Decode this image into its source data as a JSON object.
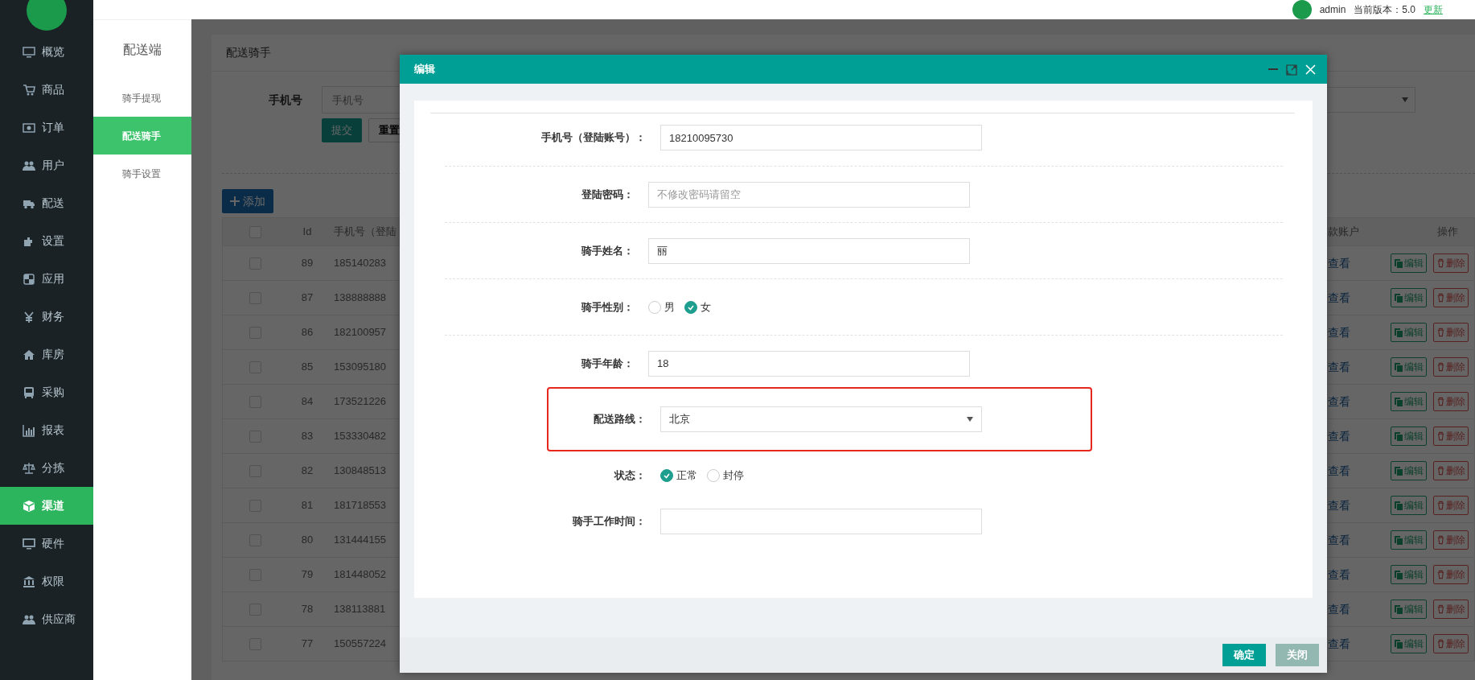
{
  "top_bar": {
    "user": "admin",
    "version": "当前版本：5.0",
    "update": "更新"
  },
  "sidebar": {
    "items": [
      {
        "label": "概览",
        "selected": false
      },
      {
        "label": "商品",
        "selected": false
      },
      {
        "label": "订单",
        "selected": false
      },
      {
        "label": "用户",
        "selected": false
      },
      {
        "label": "配送",
        "selected": false
      },
      {
        "label": "设置",
        "selected": false
      },
      {
        "label": "应用",
        "selected": false
      },
      {
        "label": "财务",
        "selected": false
      },
      {
        "label": "库房",
        "selected": false
      },
      {
        "label": "采购",
        "selected": false
      },
      {
        "label": "报表",
        "selected": false
      },
      {
        "label": "分拣",
        "selected": false
      },
      {
        "label": "渠道",
        "selected": true
      },
      {
        "label": "硬件",
        "selected": false
      },
      {
        "label": "权限",
        "selected": false
      },
      {
        "label": "供应商",
        "selected": false
      }
    ]
  },
  "subnav": {
    "title": "配送端",
    "items": [
      {
        "label": "骑手提现",
        "selected": false
      },
      {
        "label": "配送骑手",
        "selected": true
      },
      {
        "label": "骑手设置",
        "selected": false
      }
    ]
  },
  "page": {
    "title": "配送骑手",
    "filter": {
      "label": "手机号",
      "placeholder": "手机号",
      "submit": "提交",
      "reset": "重置"
    },
    "add_button": "添加",
    "table": {
      "columns": [
        "Id",
        "手机号（登陆",
        "款账户",
        "操作"
      ],
      "select_all_checked": false,
      "rows": [
        {
          "checked": false,
          "id": "89",
          "phone": "185140283",
          "link": "查看",
          "edit": "编辑",
          "delete": "删除"
        },
        {
          "checked": false,
          "id": "87",
          "phone": "138888888",
          "link": "查看",
          "edit": "编辑",
          "delete": "删除"
        },
        {
          "checked": false,
          "id": "86",
          "phone": "182100957",
          "link": "查看",
          "edit": "编辑",
          "delete": "删除"
        },
        {
          "checked": false,
          "id": "85",
          "phone": "153095180",
          "link": "查看",
          "edit": "编辑",
          "delete": "删除"
        },
        {
          "checked": false,
          "id": "84",
          "phone": "173521226",
          "link": "查看",
          "edit": "编辑",
          "delete": "删除"
        },
        {
          "checked": false,
          "id": "83",
          "phone": "153330482",
          "link": "查看",
          "edit": "编辑",
          "delete": "删除"
        },
        {
          "checked": false,
          "id": "82",
          "phone": "130848513",
          "link": "查看",
          "edit": "编辑",
          "delete": "删除"
        },
        {
          "checked": false,
          "id": "81",
          "phone": "181718553",
          "link": "查看",
          "edit": "编辑",
          "delete": "删除"
        },
        {
          "checked": false,
          "id": "80",
          "phone": "131444155",
          "link": "查看",
          "edit": "编辑",
          "delete": "删除"
        },
        {
          "checked": false,
          "id": "79",
          "phone": "181448052",
          "link": "查看",
          "edit": "编辑",
          "delete": "删除"
        },
        {
          "checked": false,
          "id": "78",
          "phone": "138113881",
          "link": "查看",
          "edit": "编辑",
          "delete": "删除"
        },
        {
          "checked": false,
          "id": "77",
          "phone": "150557224",
          "link": "查看",
          "edit": "编辑",
          "delete": "删除"
        }
      ]
    }
  },
  "dialog": {
    "title": "编辑",
    "fields": [
      {
        "kind": "text",
        "label": "手机号（登陆账号）：",
        "value": "18210095730",
        "separated": false
      },
      {
        "kind": "text",
        "label": "登陆密码：",
        "placeholder": "不修改密码请留空",
        "separated": true
      },
      {
        "kind": "text",
        "label": "骑手姓名：",
        "value": "丽",
        "separated": true
      },
      {
        "kind": "radio",
        "label": "骑手性别：",
        "options": [
          {
            "label": "男",
            "selected": false
          },
          {
            "label": "女",
            "selected": true
          }
        ],
        "separated": true
      },
      {
        "kind": "text",
        "label": "骑手年龄：",
        "value": "18",
        "separated": true
      },
      {
        "kind": "select",
        "label": "配送路线：",
        "value": "北京",
        "separated": false,
        "highlighted": true
      },
      {
        "kind": "radio",
        "label": "状态：",
        "options": [
          {
            "label": "正常",
            "selected": true
          },
          {
            "label": "封停",
            "selected": false
          }
        ],
        "separated": false
      },
      {
        "kind": "text",
        "label": "骑手工作时间：",
        "separated": false
      }
    ],
    "buttons": [
      {
        "label": "确定",
        "kind": "primary"
      },
      {
        "label": "关闭",
        "kind": "secondary"
      }
    ]
  }
}
